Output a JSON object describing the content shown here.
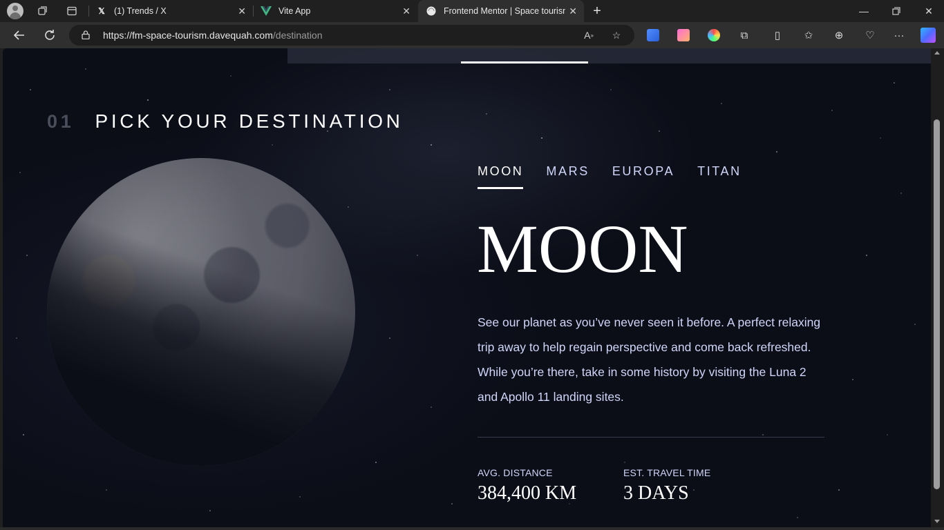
{
  "browser": {
    "tabs": [
      {
        "title": "(1) Trends / X",
        "favicon": "x-logo"
      },
      {
        "title": "Vite App",
        "favicon": "vue-logo"
      },
      {
        "title": "Frontend Mentor | Space tourism",
        "favicon": "globe-icon",
        "active": true
      }
    ],
    "url": {
      "host": "https://fm-space-tourism.davequah.com",
      "path": "/destination"
    }
  },
  "page": {
    "heading_number": "01",
    "heading_title": "PICK YOUR DESTINATION",
    "tabs": [
      "MOON",
      "MARS",
      "EUROPA",
      "TITAN"
    ],
    "active_tab": "MOON",
    "destination": {
      "name": "MOON",
      "description": "See our planet as you’ve never seen it before. A perfect relaxing trip away to help regain perspective and come back refreshed. While you’re there, take in some history by visiting the Luna 2 and Apollo 11 landing sites.",
      "distance_label": "AVG. DISTANCE",
      "distance_value": "384,400 KM",
      "travel_label": "EST. TRAVEL TIME",
      "travel_value": "3 DAYS"
    }
  },
  "colors": {
    "background": "#0b0d17",
    "text_light": "#d0d6f9",
    "white": "#ffffff"
  }
}
